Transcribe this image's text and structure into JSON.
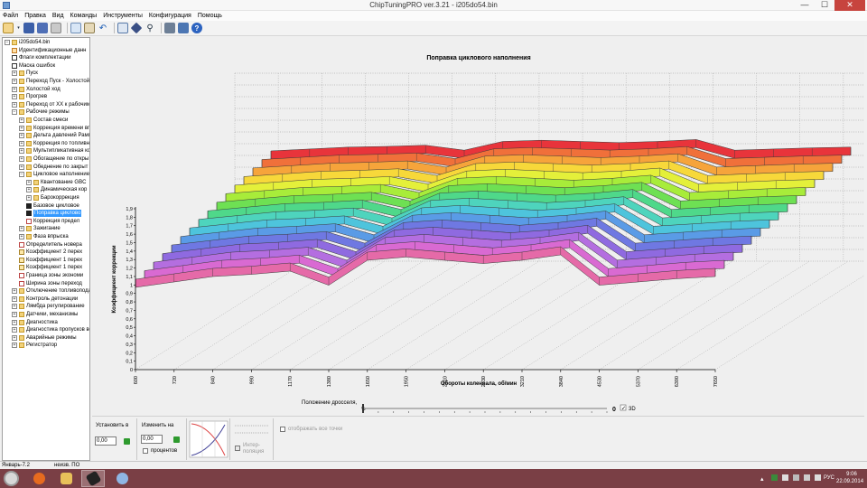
{
  "window": {
    "title": "ChipTuningPRO ver.3.21 - i205do54.bin",
    "min_label": "—",
    "max_label": "☐",
    "close_label": "✕"
  },
  "menu": [
    "Файл",
    "Правка",
    "Вид",
    "Команды",
    "Инструменты",
    "Конфигурация",
    "Помощь"
  ],
  "toolbar_icons": [
    "open-icon",
    "save-icon",
    "save-as-icon",
    "print-icon",
    "copy-icon",
    "paste-icon",
    "undo-icon",
    "edit-icon",
    "compare-icon",
    "search-icon",
    "tools-icon",
    "connect-icon",
    "help-icon"
  ],
  "tree": [
    {
      "level": 0,
      "exp": "−",
      "icon": "folder",
      "label": "i205do54.bin"
    },
    {
      "level": 1,
      "exp": "",
      "icon": "table",
      "label": "Идентификационные данн"
    },
    {
      "level": 1,
      "exp": "",
      "icon": "check",
      "label": "Флаги комплектации"
    },
    {
      "level": 1,
      "exp": "",
      "icon": "check",
      "label": "Маска ошибок"
    },
    {
      "level": 1,
      "exp": "+",
      "icon": "folder",
      "label": "Пуск"
    },
    {
      "level": 1,
      "exp": "+",
      "icon": "folder",
      "label": "Переход Пуск - Холостой х"
    },
    {
      "level": 1,
      "exp": "+",
      "icon": "folder",
      "label": "Холостой ход"
    },
    {
      "level": 1,
      "exp": "+",
      "icon": "folder",
      "label": "Прогрев"
    },
    {
      "level": 1,
      "exp": "+",
      "icon": "folder",
      "label": "Переход от ХХ к рабочим р"
    },
    {
      "level": 1,
      "exp": "−",
      "icon": "folder",
      "label": "Рабочие режимы"
    },
    {
      "level": 2,
      "exp": "+",
      "icon": "folder",
      "label": "Состав смеси"
    },
    {
      "level": 2,
      "exp": "+",
      "icon": "folder",
      "label": "Коррекция времени вп"
    },
    {
      "level": 2,
      "exp": "+",
      "icon": "folder",
      "label": "Дельта давлений Рамп"
    },
    {
      "level": 2,
      "exp": "+",
      "icon": "folder",
      "label": "Коррекция по топливн"
    },
    {
      "level": 2,
      "exp": "+",
      "icon": "folder",
      "label": "Мультипликативная ко"
    },
    {
      "level": 2,
      "exp": "+",
      "icon": "folder",
      "label": "Обогащение по откры"
    },
    {
      "level": 2,
      "exp": "+",
      "icon": "folder",
      "label": "Обеднение по закрыт"
    },
    {
      "level": 2,
      "exp": "−",
      "icon": "folder",
      "label": "Цикловое наполнение"
    },
    {
      "level": 3,
      "exp": "+",
      "icon": "folder",
      "label": "Квантование GBC"
    },
    {
      "level": 3,
      "exp": "+",
      "icon": "folder",
      "label": "Динамическая кор"
    },
    {
      "level": 3,
      "exp": "+",
      "icon": "folder",
      "label": "Барокоррекция"
    },
    {
      "level": 3,
      "exp": "",
      "icon": "dark",
      "label": "Базовое цикловое"
    },
    {
      "level": 3,
      "exp": "",
      "icon": "dark",
      "label": "Поправка циклово",
      "selected": true
    },
    {
      "level": 3,
      "exp": "",
      "icon": "graph",
      "label": "Коррекция предел"
    },
    {
      "level": 2,
      "exp": "+",
      "icon": "folder",
      "label": "Зажигание"
    },
    {
      "level": 2,
      "exp": "+",
      "icon": "folder",
      "label": "Фаза впрыска"
    },
    {
      "level": 2,
      "exp": "",
      "icon": "graph",
      "label": "Определитель новера"
    },
    {
      "level": 2,
      "exp": "",
      "icon": "num",
      "label": "Коэффициент 2 перех"
    },
    {
      "level": 2,
      "exp": "",
      "icon": "num",
      "label": "Коэффициент 1 перех"
    },
    {
      "level": 2,
      "exp": "",
      "icon": "num",
      "label": "Коэффициент 1 перех"
    },
    {
      "level": 2,
      "exp": "",
      "icon": "graph",
      "label": "Граница зоны экономи"
    },
    {
      "level": 2,
      "exp": "",
      "icon": "graph",
      "label": "Ширина зоны переход"
    },
    {
      "level": 1,
      "exp": "+",
      "icon": "folder",
      "label": "Отключение топливопода"
    },
    {
      "level": 1,
      "exp": "+",
      "icon": "folder",
      "label": "Контроль детонации"
    },
    {
      "level": 1,
      "exp": "+",
      "icon": "folder",
      "label": "Лямбда регулирование"
    },
    {
      "level": 1,
      "exp": "+",
      "icon": "folder",
      "label": "Датчики, механизмы"
    },
    {
      "level": 1,
      "exp": "+",
      "icon": "folder",
      "label": "Диагностика"
    },
    {
      "level": 1,
      "exp": "+",
      "icon": "folder",
      "label": "Диагностика пропусков вс"
    },
    {
      "level": 1,
      "exp": "+",
      "icon": "folder",
      "label": "Аварийные режимы"
    },
    {
      "level": 1,
      "exp": "+",
      "icon": "folder",
      "label": "Регистратор"
    }
  ],
  "chart": {
    "title": "Поправка циклового наполнения",
    "ylabel": "Коэффициент коррекции",
    "xlabel": "Обороты коленвала, об/мин",
    "y_ticks": [
      "1,9",
      "1,8",
      "1,7",
      "1,6",
      "1,5",
      "1,4",
      "1,3",
      "1,2",
      "1,1",
      "1",
      "0,9",
      "0,8",
      "0,7",
      "0,6",
      "0,5",
      "0,4",
      "0,3",
      "0,2",
      "0,1",
      "0"
    ],
    "x_ticks": [
      "600",
      "720",
      "840",
      "990",
      "1170",
      "1380",
      "1650",
      "1950",
      "2310",
      "2730",
      "3210",
      "3840",
      "4530",
      "5370",
      "6390",
      "7650"
    ]
  },
  "chart_data": {
    "type": "area",
    "title": "Поправка циклового наполнения",
    "xlabel": "Обороты коленвала, об/мин",
    "ylabel": "Коэффициент коррекции",
    "ylim": [
      0,
      2
    ],
    "x": [
      600,
      720,
      840,
      990,
      1170,
      1380,
      1650,
      1950,
      2310,
      2730,
      3210,
      3840,
      4530,
      5370,
      6390,
      7650
    ],
    "series": [
      {
        "values": [
          1.0,
          1.05,
          1.1,
          1.12,
          1.15,
          1.02,
          1.25,
          1.28,
          1.25,
          1.22,
          1.25,
          1.3,
          1.02,
          1.05,
          1.08,
          1.1
        ]
      }
    ]
  },
  "slider": {
    "label": "Положение дросселя,",
    "unit": "%",
    "value": "0",
    "check_3d": "3D"
  },
  "bottom": {
    "set_label": "Установить в",
    "set_value": "0,00",
    "change_label": "Изменить на",
    "change_value": "0,00",
    "percent_label": "процентов",
    "interp_label": "Интер-\nполяция",
    "show_points_label": "отображать все точки"
  },
  "status": {
    "left": "Январь-7.2",
    "mid": "неизв. ПО"
  },
  "tray": {
    "lang": "РУС",
    "time": "9:06",
    "date": "22.09.2014"
  },
  "colors": {
    "taskbar": "#7a3f45",
    "selection": "#3399ff",
    "grid": "#4d4d4d"
  }
}
